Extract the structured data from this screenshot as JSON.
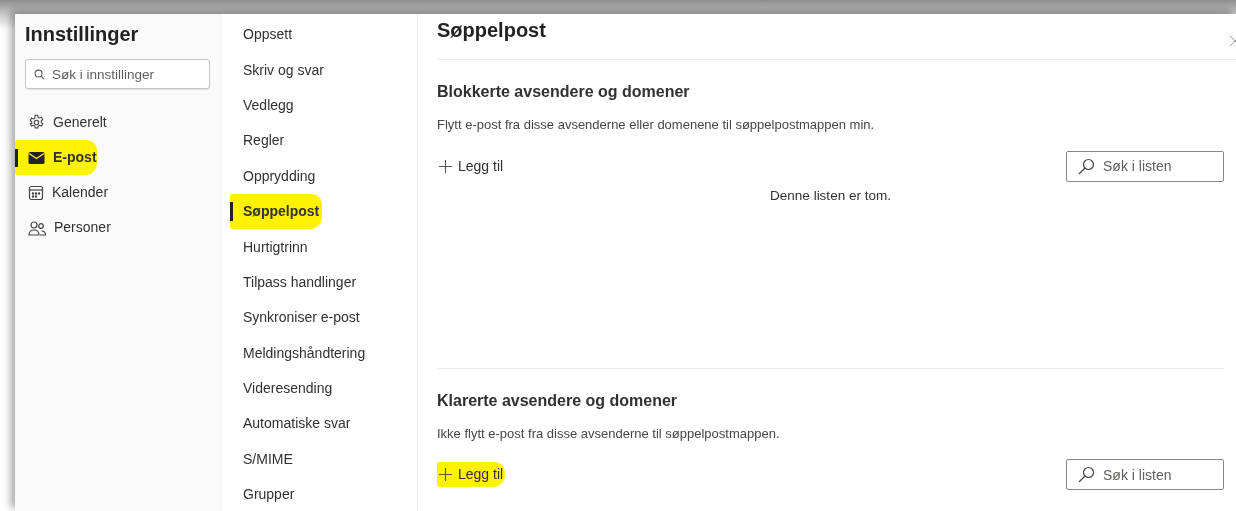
{
  "sidebar": {
    "title": "Innstillinger",
    "search": {
      "placeholder": "Søk i innstillinger"
    },
    "items": [
      {
        "label": "Generelt",
        "selected": false,
        "highlighted": false
      },
      {
        "label": "E-post",
        "selected": true,
        "highlighted": true
      },
      {
        "label": "Kalender",
        "selected": false,
        "highlighted": false
      },
      {
        "label": "Personer",
        "selected": false,
        "highlighted": false
      }
    ]
  },
  "subnav": {
    "items": [
      {
        "label": "Oppsett",
        "selected": false,
        "highlighted": false
      },
      {
        "label": "Skriv og svar",
        "selected": false,
        "highlighted": false
      },
      {
        "label": "Vedlegg",
        "selected": false,
        "highlighted": false
      },
      {
        "label": "Regler",
        "selected": false,
        "highlighted": false
      },
      {
        "label": "Opprydding",
        "selected": false,
        "highlighted": false
      },
      {
        "label": "Søppelpost",
        "selected": true,
        "highlighted": true
      },
      {
        "label": "Hurtigtrinn",
        "selected": false,
        "highlighted": false
      },
      {
        "label": "Tilpass handlinger",
        "selected": false,
        "highlighted": false
      },
      {
        "label": "Synkroniser e-post",
        "selected": false,
        "highlighted": false
      },
      {
        "label": "Meldingshåndtering",
        "selected": false,
        "highlighted": false
      },
      {
        "label": "Videresending",
        "selected": false,
        "highlighted": false
      },
      {
        "label": "Automatiske svar",
        "selected": false,
        "highlighted": false
      },
      {
        "label": "S/MIME",
        "selected": false,
        "highlighted": false
      },
      {
        "label": "Grupper",
        "selected": false,
        "highlighted": false
      }
    ]
  },
  "content": {
    "title": "Søppelpost",
    "sections": [
      {
        "heading": "Blokkerte avsendere og domener",
        "description": "Flytt e-post fra disse avsenderne eller domenene til søppelpostmappen min.",
        "add": {
          "label": "Legg til",
          "highlighted": false
        },
        "search": {
          "placeholder": "Søk i listen"
        },
        "empty_message": "Denne listen er tom."
      },
      {
        "heading": "Klarerte avsendere og domener",
        "description": "Ikke flytt e-post fra disse avsenderne til søppelpostmappen.",
        "add": {
          "label": "Legg til",
          "highlighted": true
        },
        "search": {
          "placeholder": "Søk i listen"
        }
      }
    ]
  }
}
